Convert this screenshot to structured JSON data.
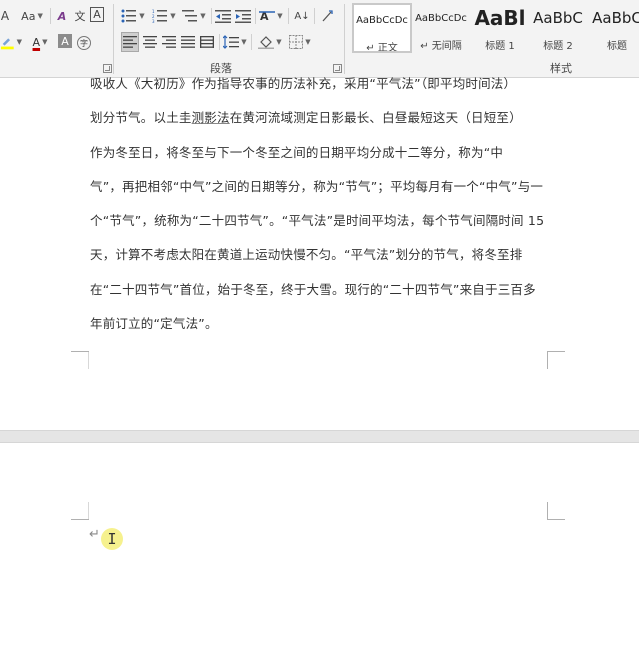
{
  "ribbon": {
    "font_group": {
      "font_size_change_glyph": "Aa",
      "clear_format_glyph": "A",
      "phonetic_glyph": "文",
      "char_border_glyph": "A",
      "font_color_glyph": "A",
      "char_shading_glyph": "A",
      "enclose_char_glyph": "字"
    },
    "paragraph_group": {
      "label": "段落",
      "sort_glyph": "A↓"
    },
    "styles_group": {
      "label": "样式",
      "tiles": [
        {
          "sample": "AaBbCcDc",
          "name": "↵ 正文",
          "selected": true
        },
        {
          "sample": "AaBbCcDc",
          "name": "↵ 无间隔",
          "selected": false
        },
        {
          "sample": "AaBl",
          "name": "标题 1",
          "selected": false
        },
        {
          "sample": "AaBbC",
          "name": "标题 2",
          "selected": false
        },
        {
          "sample": "AaBbC",
          "name": "标题",
          "selected": false
        }
      ]
    }
  },
  "document": {
    "lines": [
      "吸收人《大初历》作为指导农事的历法补充，采用“平气法”（即平均时间法）",
      "划分节气。以土圭",
      "测影法",
      "在黄河流域测定日影最长、白昼最短这天（日短至）",
      "作为冬至日，将冬至与下一个冬至之间的日期平均分成十二等分，称为“中",
      "气”，再把相邻“中气”之间的日期等分，称为“节气”；平均每月有一个“中气”与一",
      "个“节气”，统称为“二十四节气”。“平气法”是时间平均法，每个节气间隔时间 15",
      "天，计算不考虑太阳在黄道上运动快慢不匀。“平气法”划分的节气，将冬至排",
      "在“二十四节气”首位，始于冬至，终于大雪。现行的“二十四节气”来自于三百多",
      "年前订立的“定气法”。"
    ],
    "page2_mark": "↵",
    "cursor_glyph": "I"
  },
  "colors": {
    "font_color_bar": "#c00000",
    "highlight_bar": "#ffff00",
    "cursor_highlight": "#f5ee7a"
  }
}
